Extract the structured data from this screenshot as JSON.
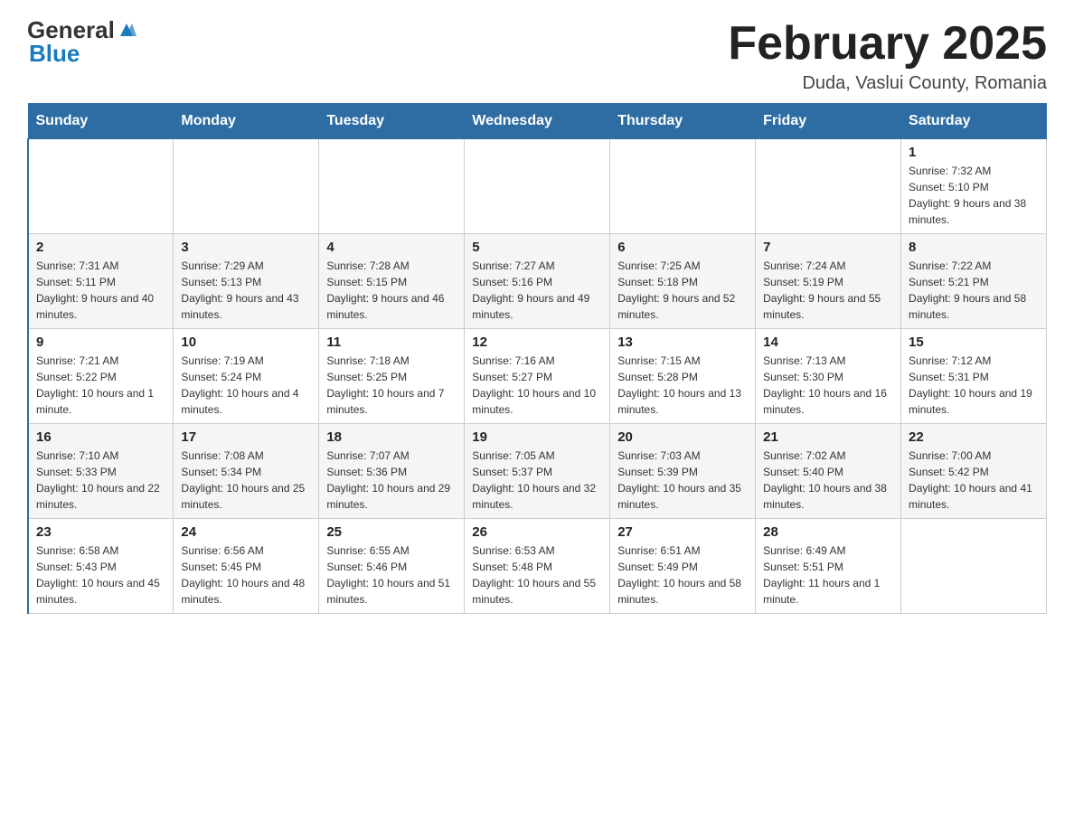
{
  "header": {
    "logo_general": "General",
    "logo_blue": "Blue",
    "month_title": "February 2025",
    "location": "Duda, Vaslui County, Romania"
  },
  "weekdays": [
    "Sunday",
    "Monday",
    "Tuesday",
    "Wednesday",
    "Thursday",
    "Friday",
    "Saturday"
  ],
  "weeks": [
    {
      "days": [
        {
          "number": "",
          "info": ""
        },
        {
          "number": "",
          "info": ""
        },
        {
          "number": "",
          "info": ""
        },
        {
          "number": "",
          "info": ""
        },
        {
          "number": "",
          "info": ""
        },
        {
          "number": "",
          "info": ""
        },
        {
          "number": "1",
          "info": "Sunrise: 7:32 AM\nSunset: 5:10 PM\nDaylight: 9 hours and 38 minutes."
        }
      ]
    },
    {
      "days": [
        {
          "number": "2",
          "info": "Sunrise: 7:31 AM\nSunset: 5:11 PM\nDaylight: 9 hours and 40 minutes."
        },
        {
          "number": "3",
          "info": "Sunrise: 7:29 AM\nSunset: 5:13 PM\nDaylight: 9 hours and 43 minutes."
        },
        {
          "number": "4",
          "info": "Sunrise: 7:28 AM\nSunset: 5:15 PM\nDaylight: 9 hours and 46 minutes."
        },
        {
          "number": "5",
          "info": "Sunrise: 7:27 AM\nSunset: 5:16 PM\nDaylight: 9 hours and 49 minutes."
        },
        {
          "number": "6",
          "info": "Sunrise: 7:25 AM\nSunset: 5:18 PM\nDaylight: 9 hours and 52 minutes."
        },
        {
          "number": "7",
          "info": "Sunrise: 7:24 AM\nSunset: 5:19 PM\nDaylight: 9 hours and 55 minutes."
        },
        {
          "number": "8",
          "info": "Sunrise: 7:22 AM\nSunset: 5:21 PM\nDaylight: 9 hours and 58 minutes."
        }
      ]
    },
    {
      "days": [
        {
          "number": "9",
          "info": "Sunrise: 7:21 AM\nSunset: 5:22 PM\nDaylight: 10 hours and 1 minute."
        },
        {
          "number": "10",
          "info": "Sunrise: 7:19 AM\nSunset: 5:24 PM\nDaylight: 10 hours and 4 minutes."
        },
        {
          "number": "11",
          "info": "Sunrise: 7:18 AM\nSunset: 5:25 PM\nDaylight: 10 hours and 7 minutes."
        },
        {
          "number": "12",
          "info": "Sunrise: 7:16 AM\nSunset: 5:27 PM\nDaylight: 10 hours and 10 minutes."
        },
        {
          "number": "13",
          "info": "Sunrise: 7:15 AM\nSunset: 5:28 PM\nDaylight: 10 hours and 13 minutes."
        },
        {
          "number": "14",
          "info": "Sunrise: 7:13 AM\nSunset: 5:30 PM\nDaylight: 10 hours and 16 minutes."
        },
        {
          "number": "15",
          "info": "Sunrise: 7:12 AM\nSunset: 5:31 PM\nDaylight: 10 hours and 19 minutes."
        }
      ]
    },
    {
      "days": [
        {
          "number": "16",
          "info": "Sunrise: 7:10 AM\nSunset: 5:33 PM\nDaylight: 10 hours and 22 minutes."
        },
        {
          "number": "17",
          "info": "Sunrise: 7:08 AM\nSunset: 5:34 PM\nDaylight: 10 hours and 25 minutes."
        },
        {
          "number": "18",
          "info": "Sunrise: 7:07 AM\nSunset: 5:36 PM\nDaylight: 10 hours and 29 minutes."
        },
        {
          "number": "19",
          "info": "Sunrise: 7:05 AM\nSunset: 5:37 PM\nDaylight: 10 hours and 32 minutes."
        },
        {
          "number": "20",
          "info": "Sunrise: 7:03 AM\nSunset: 5:39 PM\nDaylight: 10 hours and 35 minutes."
        },
        {
          "number": "21",
          "info": "Sunrise: 7:02 AM\nSunset: 5:40 PM\nDaylight: 10 hours and 38 minutes."
        },
        {
          "number": "22",
          "info": "Sunrise: 7:00 AM\nSunset: 5:42 PM\nDaylight: 10 hours and 41 minutes."
        }
      ]
    },
    {
      "days": [
        {
          "number": "23",
          "info": "Sunrise: 6:58 AM\nSunset: 5:43 PM\nDaylight: 10 hours and 45 minutes."
        },
        {
          "number": "24",
          "info": "Sunrise: 6:56 AM\nSunset: 5:45 PM\nDaylight: 10 hours and 48 minutes."
        },
        {
          "number": "25",
          "info": "Sunrise: 6:55 AM\nSunset: 5:46 PM\nDaylight: 10 hours and 51 minutes."
        },
        {
          "number": "26",
          "info": "Sunrise: 6:53 AM\nSunset: 5:48 PM\nDaylight: 10 hours and 55 minutes."
        },
        {
          "number": "27",
          "info": "Sunrise: 6:51 AM\nSunset: 5:49 PM\nDaylight: 10 hours and 58 minutes."
        },
        {
          "number": "28",
          "info": "Sunrise: 6:49 AM\nSunset: 5:51 PM\nDaylight: 11 hours and 1 minute."
        },
        {
          "number": "",
          "info": ""
        }
      ]
    }
  ]
}
